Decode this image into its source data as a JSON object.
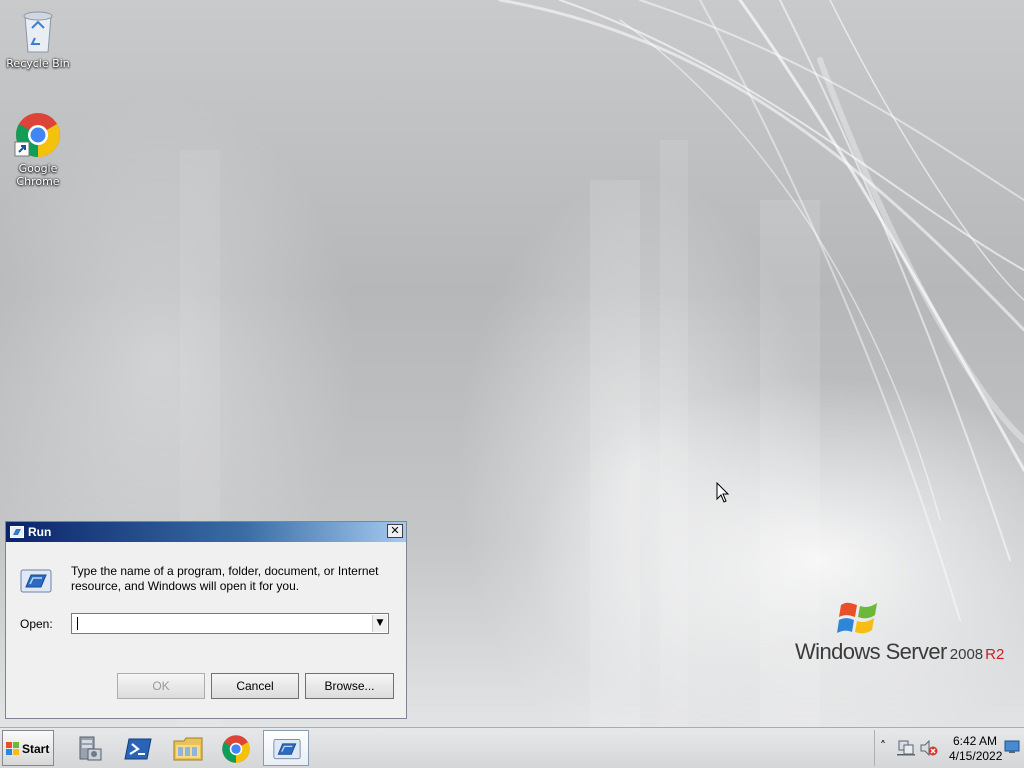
{
  "desktop": {
    "icons": [
      {
        "label": "Recycle Bin",
        "icon": "recycle-bin-icon"
      },
      {
        "label": "Google Chrome",
        "icon": "chrome-icon"
      }
    ],
    "branding": {
      "windows": "Windows",
      "server": "Server",
      "version": "2008",
      "edition": "R2"
    }
  },
  "run_dialog": {
    "title": "Run",
    "description": "Type the name of a program, folder, document, or Internet resource, and Windows will open it for you.",
    "open_label": "Open:",
    "open_value": "",
    "buttons": {
      "ok": "OK",
      "cancel": "Cancel",
      "browse": "Browse..."
    },
    "close_glyph": "✕"
  },
  "taskbar": {
    "start_label": "Start",
    "pinned": [
      "server-manager-icon",
      "powershell-icon",
      "explorer-icon",
      "chrome-icon",
      "run-icon"
    ],
    "active_item": "run-icon"
  },
  "tray": {
    "chevron": "˄",
    "time": "6:42 AM",
    "date": "4/15/2022"
  },
  "colors": {
    "title_bar_start": "#0a246a",
    "title_bar_end": "#a6caf0",
    "dialog_bg": "#f0f0f0",
    "r2_red": "#c8202a"
  }
}
